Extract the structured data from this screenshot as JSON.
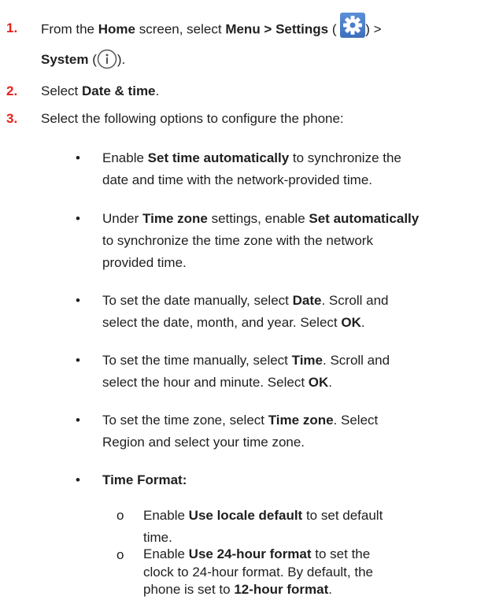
{
  "steps": [
    {
      "number": "1.",
      "line1": {
        "t1": "From the ",
        "b1": "Home",
        "t2": " screen, select ",
        "b2": "Menu > Settings",
        "t3": " (",
        "t4": ") >"
      },
      "line2": {
        "b1": "System",
        "t1": " (",
        "t2": ")."
      }
    },
    {
      "number": "2.",
      "t1": "Select ",
      "b1": "Date & time",
      "t2": "."
    },
    {
      "number": "3.",
      "t1": "Select the following options to configure the phone:"
    }
  ],
  "bullets": [
    {
      "l1": {
        "t1": "Enable ",
        "b1": "Set time automatically",
        "t2": " to synchronize the"
      },
      "l2": "date and time with the network-provided time."
    },
    {
      "l1": {
        "t1": "Under ",
        "b1": "Time zone",
        "t2": " settings, enable ",
        "b2": "Set automatically"
      },
      "l2": "to synchronize the time zone with the network",
      "l3": "provided time."
    },
    {
      "l1": {
        "t1": "To set the date manually, select ",
        "b1": "Date",
        "t2": ". Scroll and"
      },
      "l2": {
        "t1": "select the date, month, and year. Select ",
        "b1": "OK",
        "t2": "."
      }
    },
    {
      "l1": {
        "t1": "To set the time manually, select ",
        "b1": "Time",
        "t2": ". Scroll and"
      },
      "l2": {
        "t1": "select the hour and minute. Select ",
        "b1": "OK",
        "t2": "."
      }
    },
    {
      "l1": {
        "t1": "To set the time zone, select ",
        "b1": "Time zone",
        "t2": ". Select"
      },
      "l2": "Region and select your time zone."
    },
    {
      "l1": {
        "b1": "Time Format:"
      }
    }
  ],
  "subbullets": [
    {
      "l1": {
        "t1": "Enable ",
        "b1": "Use locale default",
        "t2": " to set default"
      },
      "l2": "time."
    },
    {
      "l1": {
        "t1": "Enable ",
        "b1": "Use 24-hour format",
        "t2": " to set the"
      },
      "l2": "clock to 24-hour format. By default, the",
      "l3": {
        "t1": "phone is set to ",
        "b1": "12-hour format",
        "t2": "."
      }
    }
  ],
  "bullet_char": "•",
  "subbullet_char": "o",
  "icons": {
    "settings": "gear-icon",
    "system": "info-icon"
  },
  "colors": {
    "step_number": "#e8201a",
    "settings_icon_bg": "#4a7fcb"
  }
}
